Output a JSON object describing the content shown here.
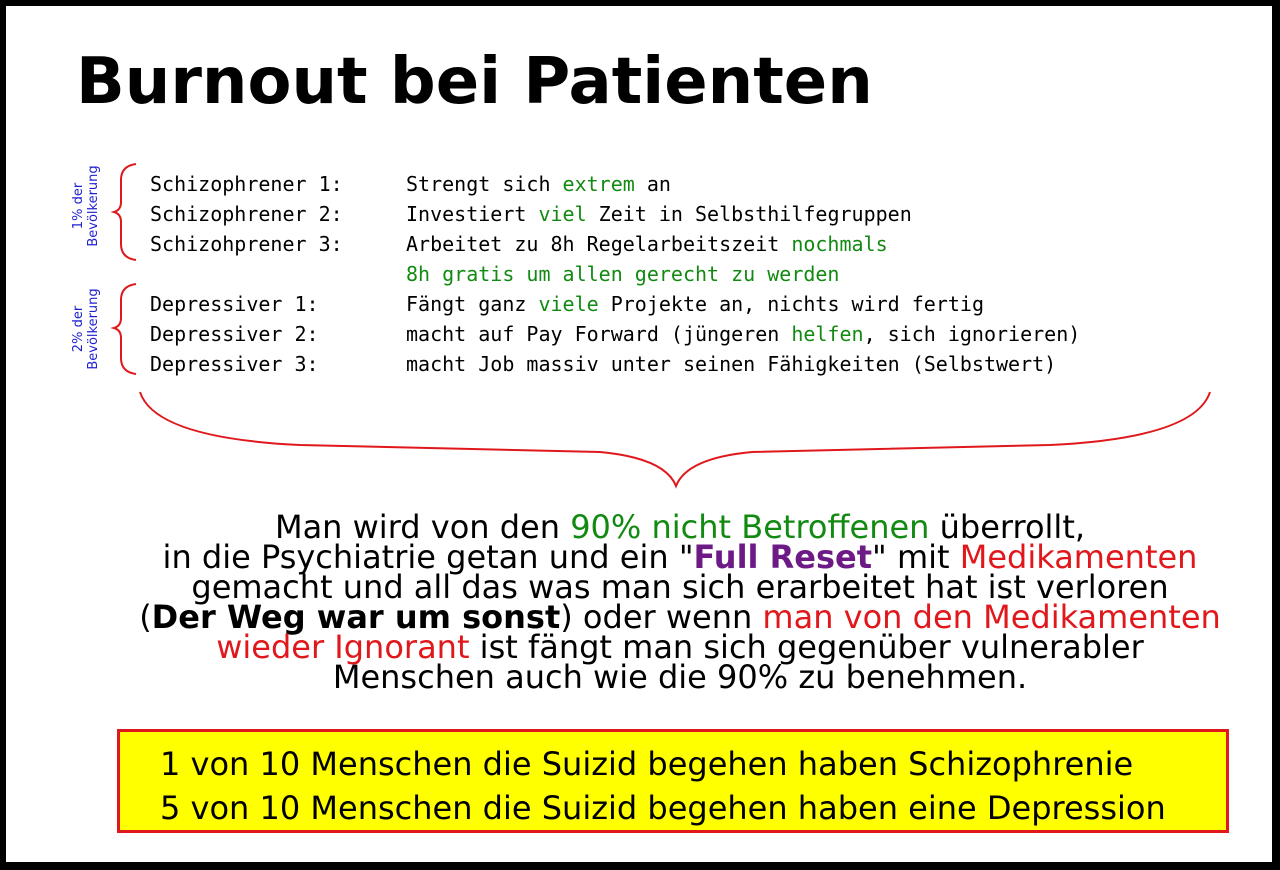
{
  "title": "Burnout bei Patienten",
  "groups": {
    "schizo_label": [
      "1% der",
      "Bevölkerung"
    ],
    "depr_label": [
      "2% der",
      "Bevölkerung"
    ]
  },
  "rows": [
    {
      "name": "Schizophrener 1:",
      "parts": [
        {
          "text": "Strengt sich ",
          "style": "plain"
        },
        {
          "text": "extrem",
          "style": "green"
        },
        {
          "text": " an",
          "style": "plain"
        }
      ]
    },
    {
      "name": "Schizophrener 2:",
      "parts": [
        {
          "text": "Investiert ",
          "style": "plain"
        },
        {
          "text": "viel",
          "style": "green"
        },
        {
          "text": " Zeit in Selbsthilfegruppen",
          "style": "plain"
        }
      ]
    },
    {
      "name": "Schizohprener 3:",
      "parts": [
        {
          "text": "Arbeitet zu 8h Regelarbeitszeit ",
          "style": "plain"
        },
        {
          "text": "nochmals",
          "style": "green"
        }
      ]
    },
    {
      "name": "",
      "parts": [
        {
          "text": "8h gratis um allen gerecht zu werden",
          "style": "green"
        }
      ]
    },
    {
      "name": "Depressiver 1:",
      "parts": [
        {
          "text": "Fängt ganz ",
          "style": "plain"
        },
        {
          "text": "viele",
          "style": "green"
        },
        {
          "text": " Projekte an, nichts wird fertig",
          "style": "plain"
        }
      ]
    },
    {
      "name": "Depressiver 2:",
      "parts": [
        {
          "text": "macht auf Pay Forward (jüngeren ",
          "style": "plain"
        },
        {
          "text": "helfen",
          "style": "green"
        },
        {
          "text": ", sich ignorieren)",
          "style": "plain"
        }
      ]
    },
    {
      "name": "Depressiver 3:",
      "parts": [
        {
          "text": "macht Job massiv unter seinen Fähigkeiten (Selbstwert)",
          "style": "plain"
        }
      ]
    }
  ],
  "summary": [
    [
      {
        "text": "Man wird von den ",
        "style": "plain"
      },
      {
        "text": "90% nicht Betroffenen",
        "style": "green"
      },
      {
        "text": " überrollt,",
        "style": "plain"
      }
    ],
    [
      {
        "text": "in die Psychiatrie getan und ein \"",
        "style": "plain"
      },
      {
        "text": "Full Reset",
        "style": "purple"
      },
      {
        "text": "\" mit ",
        "style": "plain"
      },
      {
        "text": "Medikamenten",
        "style": "red"
      }
    ],
    [
      {
        "text": "gemacht und all das was man sich erarbeitet hat ist verloren",
        "style": "plain"
      }
    ],
    [
      {
        "text": "(",
        "style": "plain"
      },
      {
        "text": "Der Weg war um sonst",
        "style": "bold"
      },
      {
        "text": ") oder wenn ",
        "style": "plain"
      },
      {
        "text": "man von den Medikamenten",
        "style": "red"
      }
    ],
    [
      {
        "text": "wieder Ignorant",
        "style": "red"
      },
      {
        "text": " ist fängt man sich gegenüber vulnerabler",
        "style": "plain"
      }
    ],
    [
      {
        "text": "Menschen auch wie die 90% zu benehmen.",
        "style": "plain"
      }
    ]
  ],
  "stats": [
    "1 von 10 Menschen die Suizid begehen haben Schizophrenie",
    "5 von 10 Menschen die Suizid begehen haben eine Depression"
  ],
  "colors": {
    "green": "#128a12",
    "red": "#e0181b",
    "purple": "#6d1a86",
    "label_blue": "#1f1fd0",
    "highlight_yellow": "#ffff00"
  }
}
